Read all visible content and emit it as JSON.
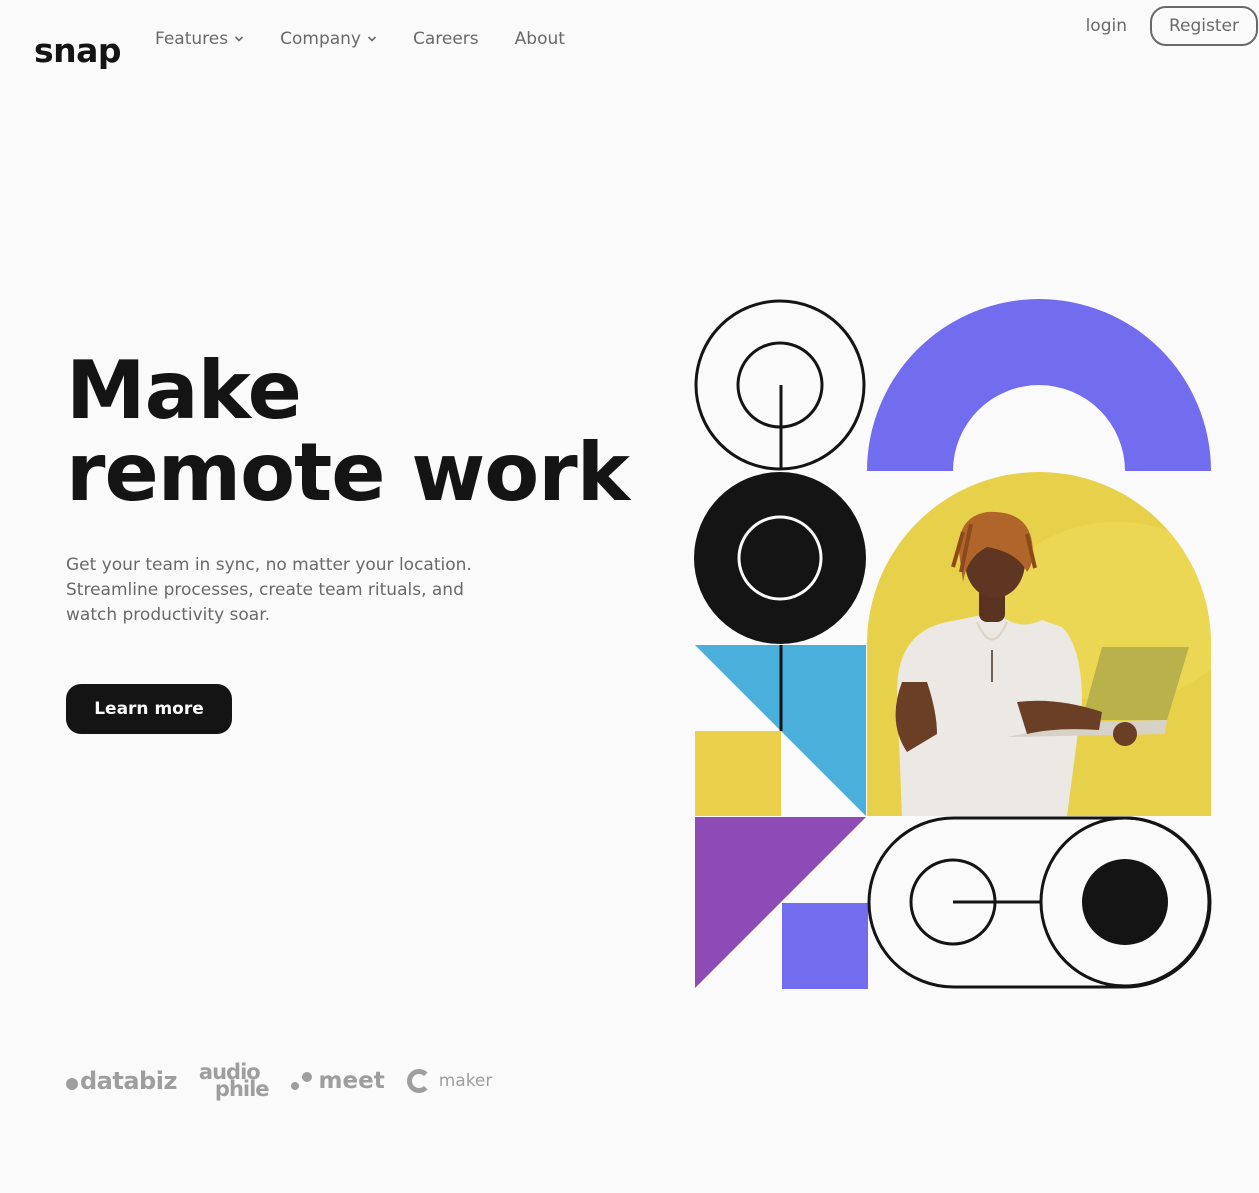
{
  "header": {
    "logo": "snap",
    "nav": [
      {
        "label": "Features",
        "has_dropdown": true
      },
      {
        "label": "Company",
        "has_dropdown": true
      },
      {
        "label": "Careers",
        "has_dropdown": false
      },
      {
        "label": "About",
        "has_dropdown": false
      }
    ],
    "login": "login",
    "register": "Register"
  },
  "hero": {
    "title_line1": "Make",
    "title_line2": "remote work",
    "subtitle": "Get your team in sync, no matter your location. Streamline processes, create team rituals, and watch productivity soar.",
    "cta": "Learn more"
  },
  "clients": {
    "databiz": "databiz",
    "audiophile_top": "audio",
    "audiophile_bottom": "phile",
    "meet": "meet",
    "maker": "maker"
  },
  "colors": {
    "text_dark": "#141414",
    "text_gray": "#696969",
    "background": "#fafafa",
    "purple": "#726CEE",
    "yellow": "#EAD04B",
    "blue": "#4AB0DB",
    "violet": "#8E4AB5",
    "client_gray": "#9e9e9e"
  },
  "icons": {
    "dropdown": "chevron-down-icon"
  }
}
